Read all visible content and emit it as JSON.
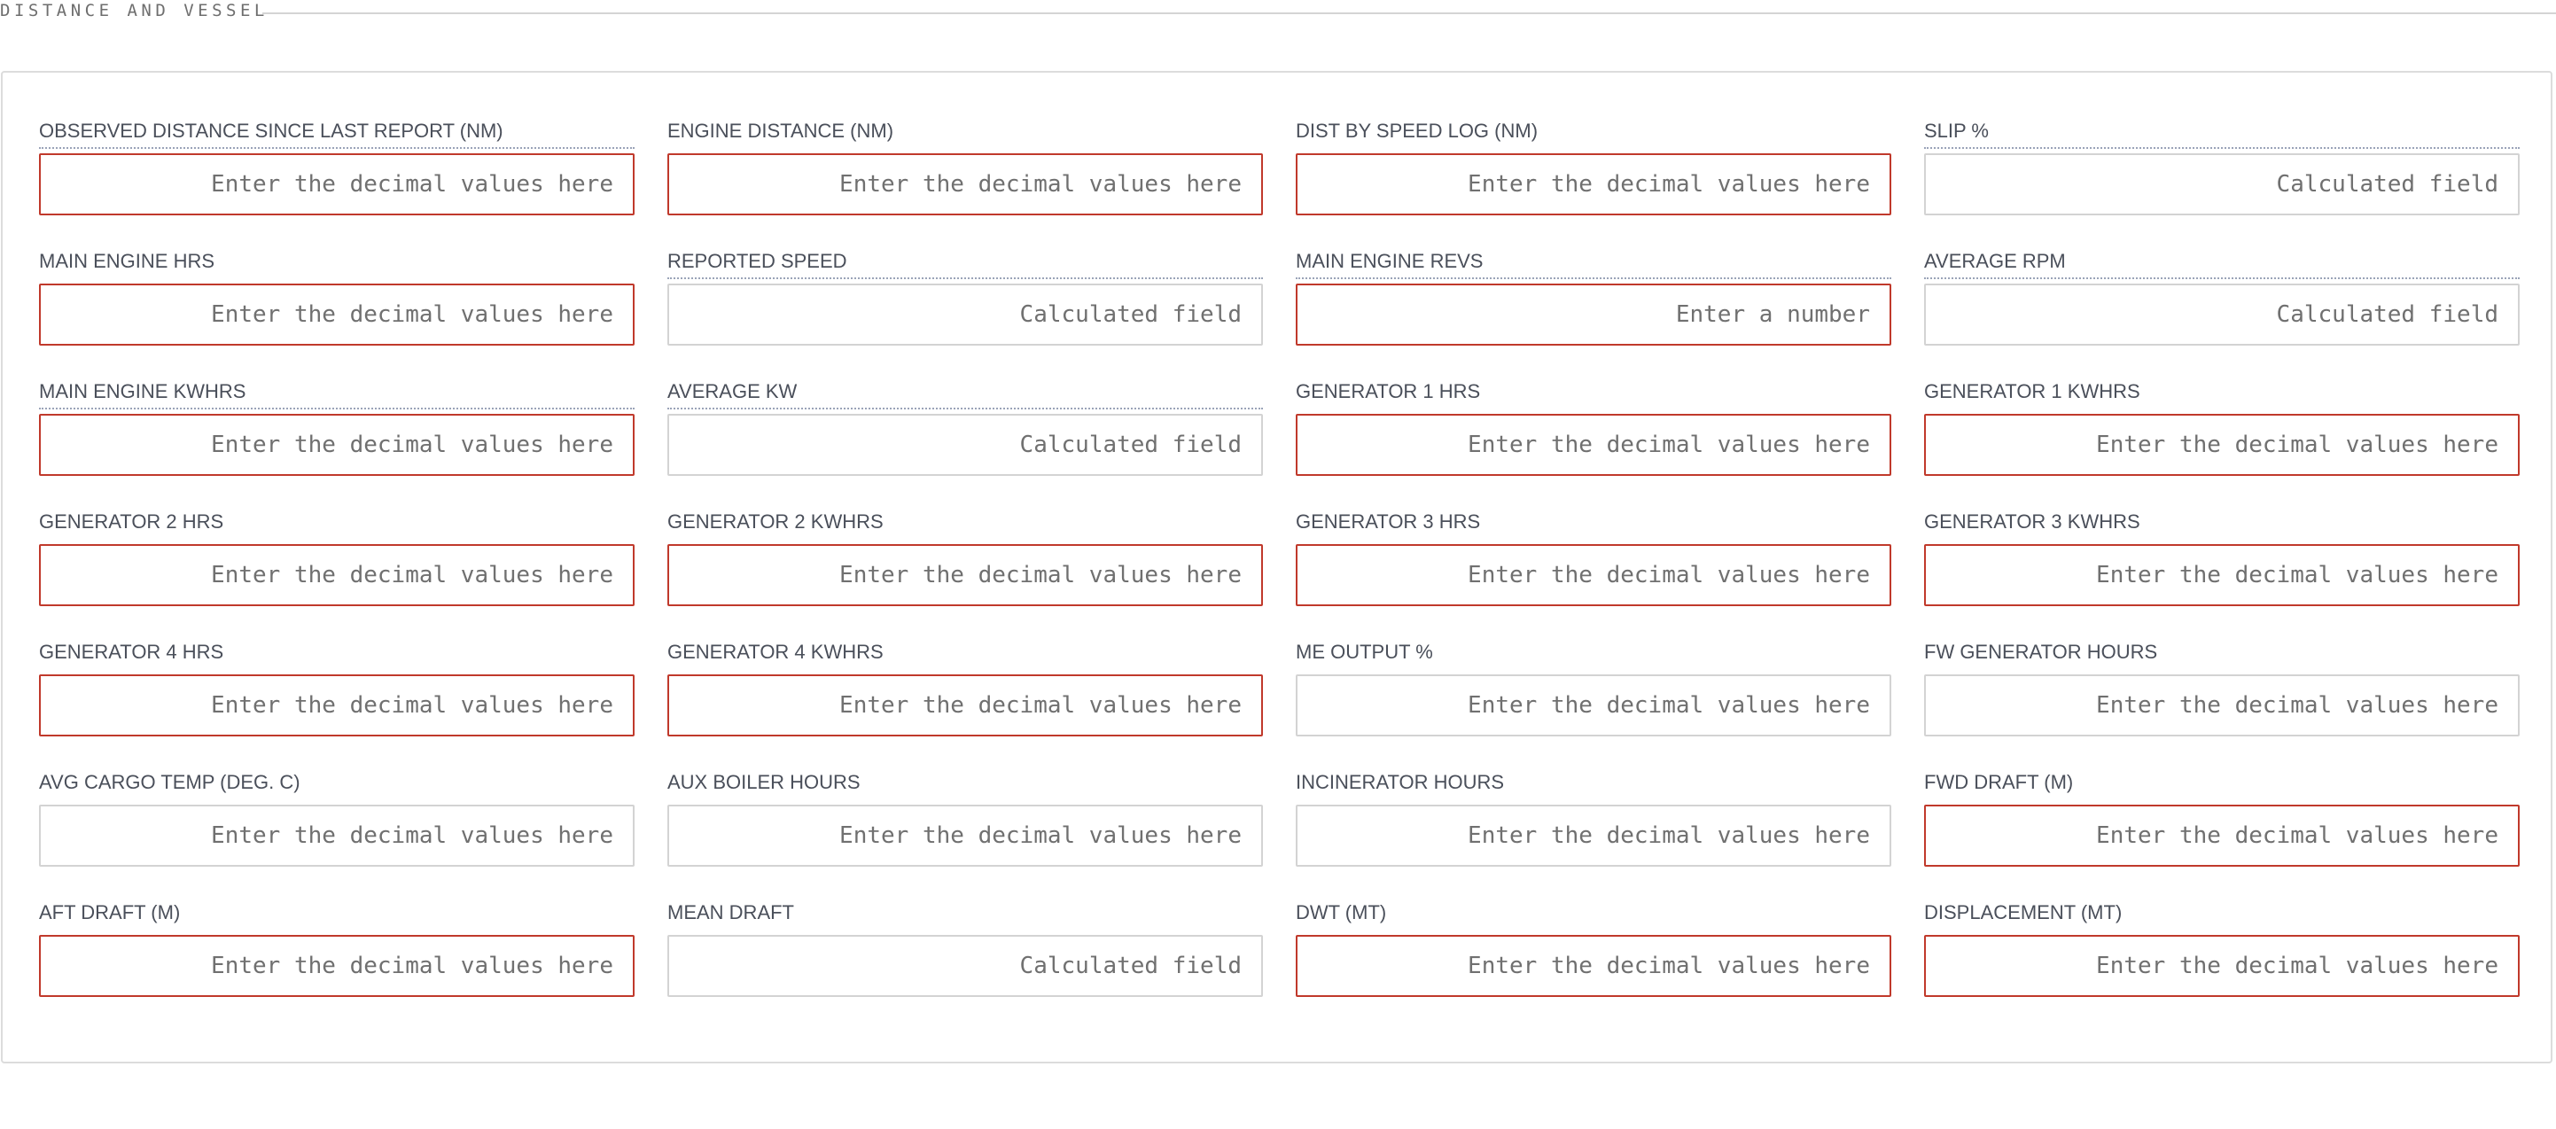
{
  "section": {
    "title": "DISTANCE AND VESSEL"
  },
  "colors": {
    "required_border": "#c0392b",
    "default_border": "#d3d3d3"
  },
  "fields": [
    {
      "label": "OBSERVED DISTANCE SINCE LAST REPORT (NM)",
      "placeholder": "Enter the decimal values here",
      "required": true,
      "dotted": true
    },
    {
      "label": "ENGINE DISTANCE (NM)",
      "placeholder": "Enter the decimal values here",
      "required": true,
      "dotted": false
    },
    {
      "label": "DIST BY SPEED LOG (NM)",
      "placeholder": "Enter the decimal values here",
      "required": true,
      "dotted": false
    },
    {
      "label": "SLIP %",
      "placeholder": "Calculated field",
      "required": false,
      "dotted": true
    },
    {
      "label": "MAIN ENGINE HRS",
      "placeholder": "Enter the decimal values here",
      "required": true,
      "dotted": false
    },
    {
      "label": "REPORTED SPEED",
      "placeholder": "Calculated field",
      "required": false,
      "dotted": true
    },
    {
      "label": "MAIN ENGINE REVS",
      "placeholder": "Enter a number",
      "required": true,
      "dotted": true
    },
    {
      "label": "AVERAGE RPM",
      "placeholder": "Calculated field",
      "required": false,
      "dotted": true
    },
    {
      "label": "MAIN ENGINE KWHRS",
      "placeholder": "Enter the decimal values here",
      "required": true,
      "dotted": true
    },
    {
      "label": "AVERAGE KW",
      "placeholder": "Calculated field",
      "required": false,
      "dotted": true
    },
    {
      "label": "GENERATOR 1 HRS",
      "placeholder": "Enter the decimal values here",
      "required": true,
      "dotted": false
    },
    {
      "label": "GENERATOR 1 KWHRS",
      "placeholder": "Enter the decimal values here",
      "required": true,
      "dotted": false
    },
    {
      "label": "GENERATOR 2 HRS",
      "placeholder": "Enter the decimal values here",
      "required": true,
      "dotted": false
    },
    {
      "label": "GENERATOR 2 KWHRS",
      "placeholder": "Enter the decimal values here",
      "required": true,
      "dotted": false
    },
    {
      "label": "GENERATOR 3 HRS",
      "placeholder": "Enter the decimal values here",
      "required": true,
      "dotted": false
    },
    {
      "label": "GENERATOR 3 KWHRS",
      "placeholder": "Enter the decimal values here",
      "required": true,
      "dotted": false
    },
    {
      "label": "GENERATOR 4 HRS",
      "placeholder": "Enter the decimal values here",
      "required": true,
      "dotted": false
    },
    {
      "label": "GENERATOR 4 KWHRS",
      "placeholder": "Enter the decimal values here",
      "required": true,
      "dotted": false
    },
    {
      "label": "ME OUTPUT %",
      "placeholder": "Enter the decimal values here",
      "required": false,
      "dotted": false
    },
    {
      "label": "FW GENERATOR HOURS",
      "placeholder": "Enter the decimal values here",
      "required": false,
      "dotted": false
    },
    {
      "label": "AVG CARGO TEMP (DEG. C)",
      "placeholder": "Enter the decimal values here",
      "required": false,
      "dotted": false
    },
    {
      "label": "AUX BOILER HOURS",
      "placeholder": "Enter the decimal values here",
      "required": false,
      "dotted": false
    },
    {
      "label": "INCINERATOR HOURS",
      "placeholder": "Enter the decimal values here",
      "required": false,
      "dotted": false
    },
    {
      "label": "FWD DRAFT (M)",
      "placeholder": "Enter the decimal values here",
      "required": true,
      "dotted": false
    },
    {
      "label": "AFT DRAFT (M)",
      "placeholder": "Enter the decimal values here",
      "required": true,
      "dotted": false
    },
    {
      "label": "MEAN DRAFT",
      "placeholder": "Calculated field",
      "required": false,
      "dotted": false
    },
    {
      "label": "DWT (MT)",
      "placeholder": "Enter the decimal values here",
      "required": true,
      "dotted": false
    },
    {
      "label": "DISPLACEMENT (MT)",
      "placeholder": "Enter the decimal values here",
      "required": true,
      "dotted": false
    }
  ]
}
